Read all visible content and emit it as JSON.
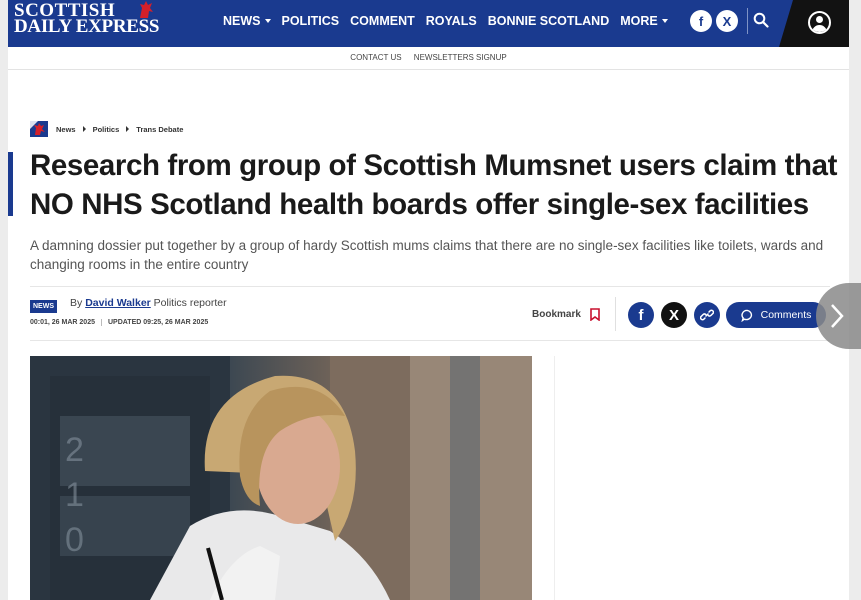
{
  "header": {
    "logo_line1": "SCOTTISH",
    "logo_line2": "DAILY EXPRESS",
    "nav": [
      "NEWS",
      "POLITICS",
      "COMMENT",
      "ROYALS",
      "BONNIE SCOTLAND",
      "MORE"
    ],
    "social": [
      "f",
      "X"
    ]
  },
  "subnav": [
    "CONTACT US",
    "NEWSLETTERS SIGNUP"
  ],
  "breadcrumb": [
    "News",
    "Politics",
    "Trans Debate"
  ],
  "article": {
    "headline": "Research from group of Scottish Mumsnet users claim that NO NHS Scotland health boards offer single-sex facilities",
    "standfirst": "A damning dossier put together by a group of hardy Scottish mums claims that there are no single-sex facilities like toilets, wards and changing rooms in the entire country",
    "badge": "NEWS",
    "by_prefix": "By",
    "author": "David Walker",
    "author_role": "Politics reporter",
    "published": "00:01, 26 MAR 2025",
    "updated": "UPDATED 09:25, 26 MAR 2025"
  },
  "actions": {
    "bookmark": "Bookmark",
    "comments": "Comments"
  },
  "colors": {
    "brand": "#1a3a8f",
    "header_dark": "#121212"
  }
}
